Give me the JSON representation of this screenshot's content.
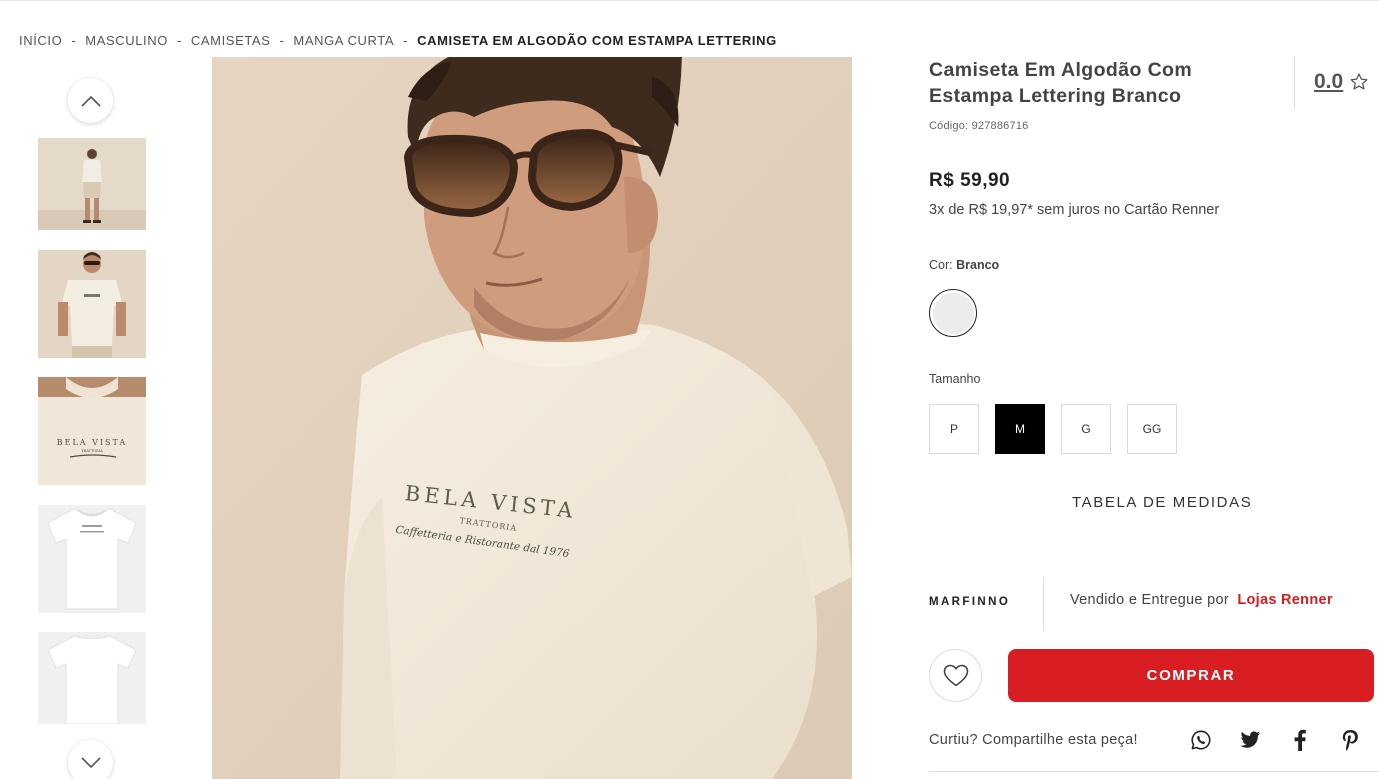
{
  "breadcrumb": {
    "items": [
      "INÍCIO",
      "MASCULINO",
      "CAMISETAS",
      "MANGA CURTA"
    ],
    "separator": "-",
    "current": "CAMISETA EM ALGODÃO COM ESTAMPA LETTERING"
  },
  "gallery": {
    "thumbnails": [
      "thumbnail-full-body",
      "thumbnail-front-model",
      "thumbnail-print-detail",
      "thumbnail-product-front",
      "thumbnail-product-back"
    ],
    "print_text": {
      "line1": "BELA VISTA",
      "line2": "TRATTORIA",
      "line3": "Caffetteria e Ristorante dal 1976"
    }
  },
  "product": {
    "title": "Camiseta Em Algodão Com Estampa Lettering Branco",
    "rating": "0.0",
    "code_label": "Código:",
    "code": "927886716",
    "price": "R$ 59,90",
    "installments": "3x de R$ 19,97* sem juros no Cartão Renner",
    "color_label": "Cor:",
    "color_value": "Branco",
    "size_label": "Tamanho",
    "sizes": [
      "P",
      "M",
      "G",
      "GG"
    ],
    "selected_size": "M",
    "size_chart": "TABELA DE MEDIDAS"
  },
  "seller": {
    "brand": "MARFINNO",
    "sold_by": "Vendido e Entregue por",
    "store": "Lojas Renner"
  },
  "actions": {
    "buy": "COMPRAR",
    "share_label": "Curtiu? Compartilhe esta peça!"
  },
  "colors": {
    "accent": "#d81e23",
    "store_link": "#d31d22",
    "selected_size_bg": "#000000"
  }
}
